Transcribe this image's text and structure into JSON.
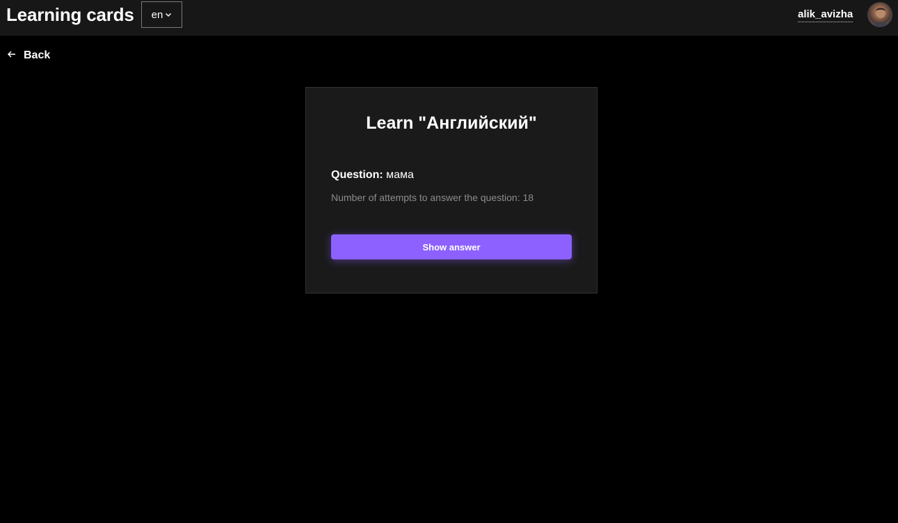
{
  "header": {
    "app_title": "Learning cards",
    "language": "en",
    "username": "alik_avizha"
  },
  "nav": {
    "back_label": "Back"
  },
  "card": {
    "title": "Learn \"Английский\"",
    "question_label": "Question:",
    "question_value": "мама",
    "attempts_text": "Number of attempts to answer the question: 18",
    "show_answer_label": "Show answer"
  },
  "colors": {
    "accent": "#8c61ff",
    "header_bg": "#171717",
    "card_bg": "#1a1a1a",
    "page_bg": "#000000"
  }
}
